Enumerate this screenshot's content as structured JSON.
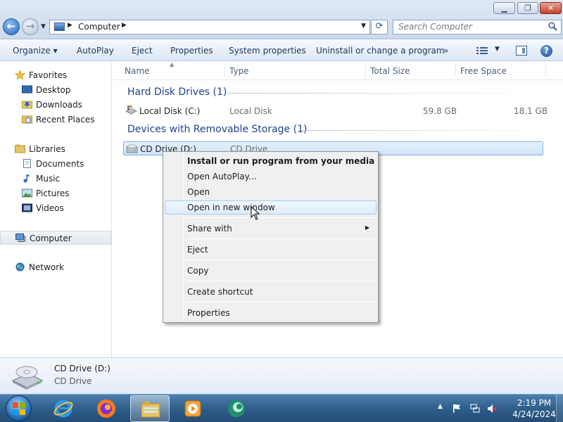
{
  "window": {
    "min_glyph": "▁",
    "max_glyph": "❐",
    "close_glyph": "✕"
  },
  "address": {
    "path": "Computer",
    "separator": "▶",
    "dropdown": "▼",
    "refresh_glyph": "⟳"
  },
  "search": {
    "placeholder": "Search Computer"
  },
  "toolbar": {
    "organize": "Organize ▾",
    "autoplay": "AutoPlay",
    "eject": "Eject",
    "properties": "Properties",
    "system_properties": "System properties",
    "uninstall": "Uninstall or change a program",
    "more": "»",
    "view_drop": "▼",
    "help": "?"
  },
  "sidebar": {
    "favorites": "Favorites",
    "desktop": "Desktop",
    "downloads": "Downloads",
    "recent_places": "Recent Places",
    "libraries": "Libraries",
    "documents": "Documents",
    "music": "Music",
    "pictures": "Pictures",
    "videos": "Videos",
    "computer": "Computer",
    "network": "Network"
  },
  "columns": {
    "name": "Name",
    "type": "Type",
    "total_size": "Total Size",
    "free_space": "Free Space",
    "sort_glyph": "▲"
  },
  "groups": {
    "hard_disk": "Hard Disk Drives (1)",
    "removable": "Devices with Removable Storage (1)"
  },
  "drives": [
    {
      "name": "Local Disk (C:)",
      "type": "Local Disk",
      "total": "59.8 GB",
      "free": "18.1 GB"
    },
    {
      "name": "CD Drive (D:)",
      "type": "CD Drive",
      "total": "",
      "free": ""
    }
  ],
  "context_menu": {
    "install": "Install or run program from your media",
    "autoplay": "Open AutoPlay...",
    "open": "Open",
    "new_window": "Open in new window",
    "share_with": "Share with",
    "share_arrow": "▶",
    "eject": "Eject",
    "copy": "Copy",
    "create_shortcut": "Create shortcut",
    "properties": "Properties"
  },
  "details": {
    "name": "CD Drive (D:)",
    "type": "CD Drive"
  },
  "taskbar": {
    "time": "2:19 PM",
    "date": "4/24/2024",
    "tray_arrow": "▲"
  },
  "colors": {
    "accent": "#1e3f8c",
    "selection": "#cfe4f9",
    "taskbar": "#2d5c88"
  }
}
